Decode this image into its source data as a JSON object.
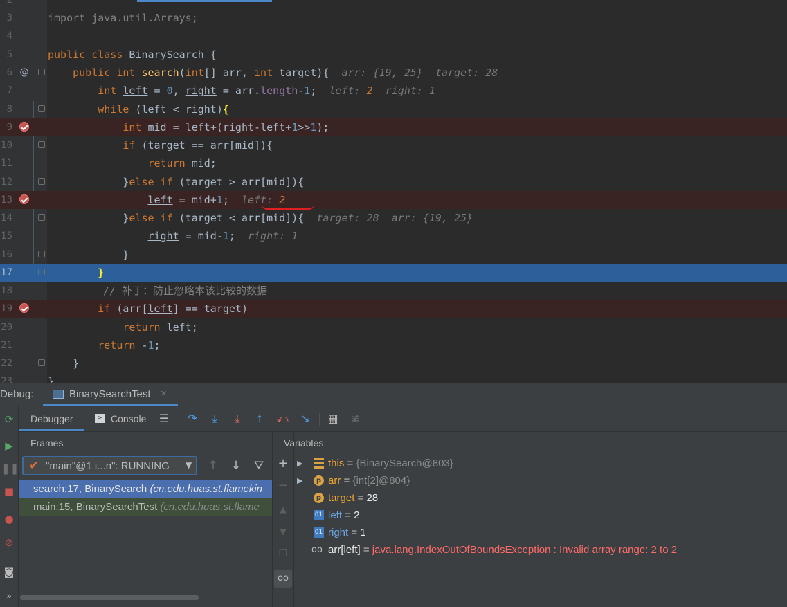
{
  "editor": {
    "hints": {
      "line6": {
        "arr_label": "arr:",
        "arr_value": "{19, 25}",
        "target_label": "target:",
        "target_value": "28"
      },
      "line7": {
        "left_label": "left:",
        "left_value": "2",
        "right_label": "right:",
        "right_value": "1"
      },
      "line13": {
        "left_label": "left:",
        "left_value": "2"
      },
      "line14": {
        "target_label": "target:",
        "target_value": "28",
        "arr_label": "arr:",
        "arr_value": "{19, 25}"
      },
      "line15": {
        "right_label": "right:",
        "right_value": "1"
      }
    },
    "comment_line18": "// 补丁：防止忽略本该比较的数据",
    "current_line": 17,
    "breakpoint_lines": [
      9,
      13,
      19
    ]
  },
  "debug": {
    "panel_title": "Debug:",
    "session_tab": "BinarySearchTest",
    "tabs": {
      "debugger": "Debugger",
      "console": "Console"
    },
    "frames": {
      "title": "Frames",
      "thread_value": "\"main\"@1 i...n\": RUNNING",
      "items": [
        {
          "method": "search:17, BinarySearch",
          "package": "(cn.edu.huas.st.flamekin"
        },
        {
          "method": "main:15, BinarySearchTest",
          "package": "(cn.edu.huas.st.flame"
        }
      ]
    },
    "variables": {
      "title": "Variables",
      "items": [
        {
          "name": "this",
          "eq": " = ",
          "value": "{BinarySearch@803}"
        },
        {
          "name": "arr",
          "eq": " = ",
          "value": "{int[2]@804}"
        },
        {
          "name": "target",
          "eq": " = ",
          "value": "28"
        },
        {
          "name": "left",
          "eq": " = ",
          "value": "2"
        },
        {
          "name": "right",
          "eq": " = ",
          "value": "1"
        },
        {
          "name": "arr[left]",
          "eq": " = ",
          "value": "java.lang.IndexOutOfBoundsException : Invalid array range: 2 to 2"
        }
      ]
    }
  },
  "colors": {
    "accent": "#4a88c7",
    "current_line": "#2d5f9a",
    "breakpoint_line": "#3a2323",
    "error": "#ff6b68"
  }
}
